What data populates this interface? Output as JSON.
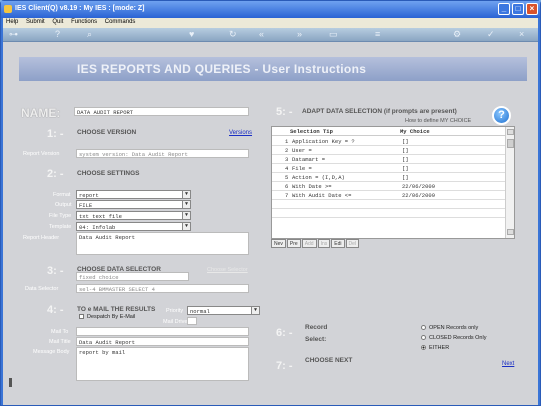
{
  "window": {
    "title": "IES Client(Q) v8.19 : My IES :     [mode: Z]"
  },
  "menu": [
    "Help",
    "Submit",
    "Quit",
    "Functions",
    "Commands"
  ],
  "banner": "IES REPORTS AND QUERIES  -  User Instructions",
  "name": {
    "label": "NAME:",
    "value": "DATA AUDIT REPORT"
  },
  "s1": {
    "num": "1: -",
    "title": "CHOOSE VERSION",
    "link": "Versions",
    "report_version_label": "Report Version",
    "report_version": "system version: Data Audit Report"
  },
  "s2": {
    "num": "2: -",
    "title": "CHOOSE SETTINGS",
    "format_label": "Format",
    "format": "report",
    "output_label": "Output",
    "output": "FILE",
    "filetype_label": "File Type",
    "filetype": "txt text file",
    "template_label": "Template",
    "template": "04: Infolab",
    "header_label": "Report Header",
    "header": "Data Audit Report"
  },
  "s3": {
    "num": "3: -",
    "title": "CHOOSE DATA SELECTOR",
    "link": "Choose Selector",
    "choice": "fixed choice",
    "selector_label": "Data Selector",
    "selector": "sel-4 BMMASTER SELECT 4"
  },
  "s4": {
    "num": "4: -",
    "title": "TO e MAIL THE RESULTS",
    "priority_label": "Priority",
    "priority": "normal",
    "despatch": "Despatch By E-Mail",
    "mail_drive_label": "Mail Drive",
    "mailto_label": "Mail To",
    "mailtitle_label": "Mail Title",
    "mailtitle": "Data Audit Report",
    "body_label": "Message Body",
    "body": "report by mail"
  },
  "s5": {
    "num": "5: -",
    "title": "ADAPT DATA SELECTION (if prompts are present)",
    "howto": "How to define MY CHOICE",
    "col_tip": "Selection Tip",
    "col_choice": "My Choice",
    "rows": [
      {
        "n": "1",
        "tip": "Application Key = ?",
        "choice": "[]"
      },
      {
        "n": "2",
        "tip": "User =",
        "choice": "[]"
      },
      {
        "n": "3",
        "tip": "Datamart =",
        "choice": "[]"
      },
      {
        "n": "4",
        "tip": "File =",
        "choice": "[]"
      },
      {
        "n": "5",
        "tip": "Action = (I,D,A)",
        "choice": "[]"
      },
      {
        "n": "6",
        "tip": "With Date >=",
        "choice": "22/06/2009"
      },
      {
        "n": "7",
        "tip": "With Audit Date <=",
        "choice": "22/06/2009"
      }
    ],
    "buttons": [
      "Nev",
      "Pre",
      "Add",
      "Ins",
      "Edi",
      "Del"
    ]
  },
  "s6": {
    "num": "6: -",
    "record": "Record",
    "select": "Select:",
    "opt1": "OPEN Records only",
    "opt2": "CLOSED Records Only",
    "opt3": "EITHER"
  },
  "s7": {
    "num": "7: -",
    "title": "CHOOSE NEXT",
    "next": "Next"
  }
}
